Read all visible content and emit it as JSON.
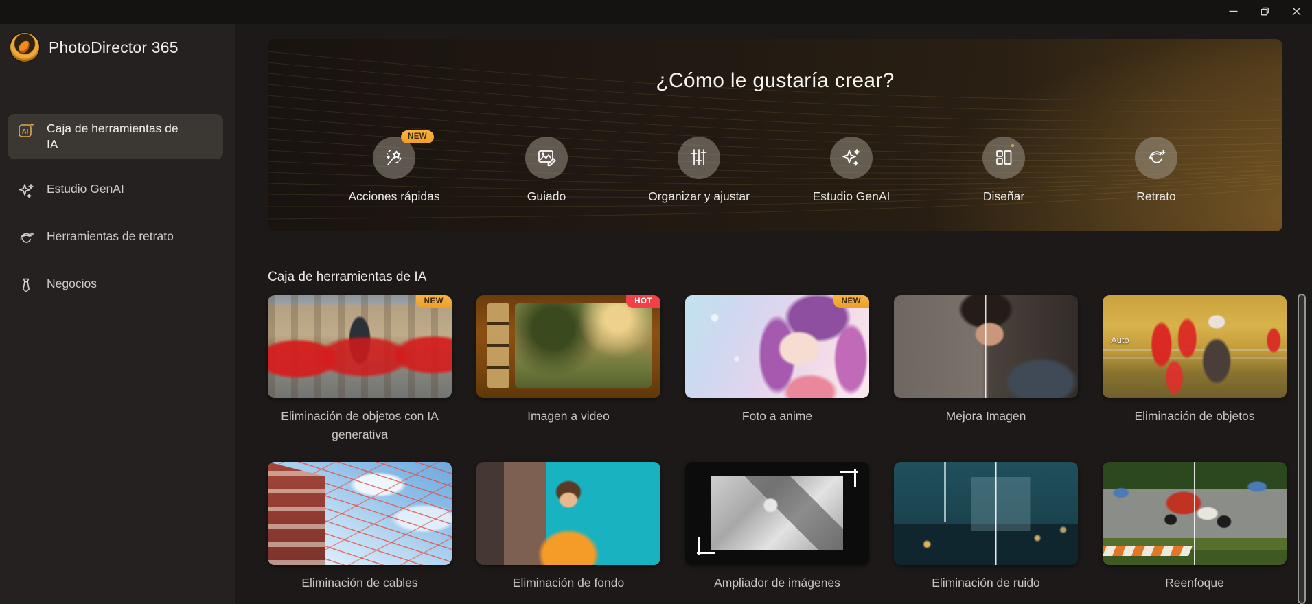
{
  "window": {
    "controls": [
      {
        "icon": "minimize-icon"
      },
      {
        "icon": "restore-icon"
      },
      {
        "icon": "close-icon"
      }
    ]
  },
  "sidebar": {
    "app_name": "PhotoDirector 365",
    "items": [
      {
        "label": "Caja de herramientas de IA",
        "icon": "ai-toolbox-icon",
        "selected": true
      },
      {
        "label": "Estudio GenAI",
        "icon": "sparkles-icon",
        "selected": false
      },
      {
        "label": "Herramientas de retrato",
        "icon": "portrait-icon",
        "selected": false
      },
      {
        "label": "Negocios",
        "icon": "business-tie-icon",
        "selected": false
      }
    ]
  },
  "banner": {
    "heading": "¿Cómo le gustaría crear?",
    "actions": [
      {
        "label": "Acciones rápidas",
        "icon": "magic-wand-icon",
        "badge": "NEW"
      },
      {
        "label": "Guiado",
        "icon": "image-edit-icon"
      },
      {
        "label": "Organizar y ajustar",
        "icon": "adjust-sliders-icon"
      },
      {
        "label": "Estudio GenAI",
        "icon": "gen-ai-sparkles-icon"
      },
      {
        "label": "Diseñar",
        "icon": "layout-icon"
      },
      {
        "label": "Retrato",
        "icon": "portrait-icon"
      }
    ]
  },
  "section": {
    "title": "Caja de herramientas de IA",
    "cards": [
      {
        "label": "Eliminación de objetos con IA generativa",
        "badge": "NEW"
      },
      {
        "label": "Imagen a video",
        "badge": "HOT"
      },
      {
        "label": "Foto a anime",
        "badge": "NEW"
      },
      {
        "label": "Mejora Imagen"
      },
      {
        "label": "Eliminación de objetos",
        "overlay": "Auto"
      },
      {
        "label": "Eliminación de cables"
      },
      {
        "label": "Eliminación de fondo"
      },
      {
        "label": "Ampliador de imágenes"
      },
      {
        "label": "Eliminación de ruido"
      },
      {
        "label": "Reenfoque"
      }
    ]
  },
  "colors": {
    "accent_gold": "#e2a74c",
    "badge_new": "#f2a937",
    "badge_hot": "#f04048",
    "titlebar_bg": "#151212",
    "sidebar_bg": "#242120",
    "main_bg": "#1c1918",
    "selected_item_bg": "#3b3733"
  }
}
